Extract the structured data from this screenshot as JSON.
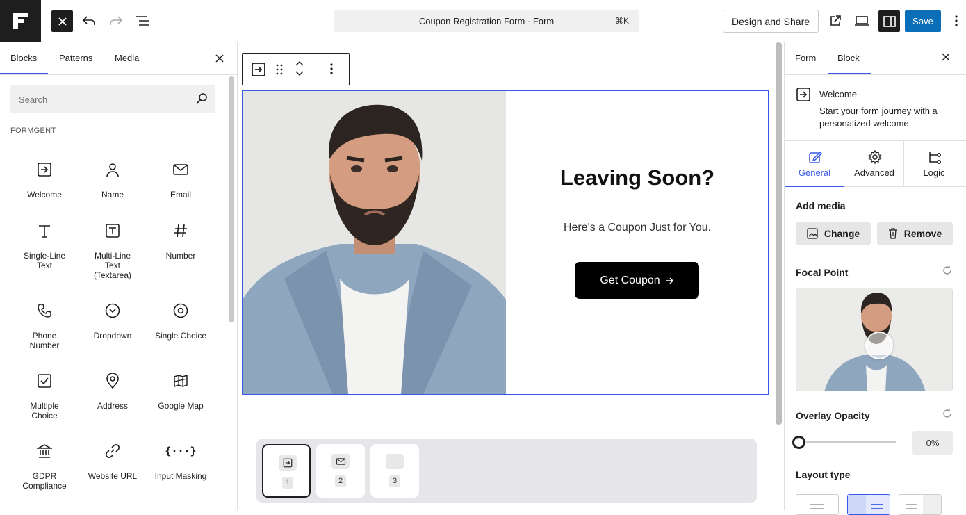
{
  "topbar": {
    "command_title": "Coupon Registration Form · Form",
    "command_shortcut": "⌘K",
    "design_share_label": "Design and Share",
    "save_label": "Save"
  },
  "inserter": {
    "tabs": [
      "Blocks",
      "Patterns",
      "Media"
    ],
    "search_placeholder": "Search",
    "category": "FORMGENT",
    "blocks": [
      {
        "label": "Welcome",
        "icon": "welcome-icon"
      },
      {
        "label": "Name",
        "icon": "person-icon"
      },
      {
        "label": "Email",
        "icon": "envelope-icon"
      },
      {
        "label": "Single-Line Text",
        "icon": "text-t-icon"
      },
      {
        "label": "Multi-Line Text (Textarea)",
        "icon": "text-box-icon"
      },
      {
        "label": "Number",
        "icon": "hash-icon"
      },
      {
        "label": "Phone Number",
        "icon": "phone-icon"
      },
      {
        "label": "Dropdown",
        "icon": "chevron-circle-icon"
      },
      {
        "label": "Single Choice",
        "icon": "radio-icon"
      },
      {
        "label": "Multiple Choice",
        "icon": "checkbox-icon"
      },
      {
        "label": "Address",
        "icon": "map-pin-icon"
      },
      {
        "label": "Google Map",
        "icon": "map-icon"
      },
      {
        "label": "GDPR Compliance",
        "icon": "bank-icon"
      },
      {
        "label": "Website URL",
        "icon": "link-icon"
      },
      {
        "label": "Input Masking",
        "icon": "braces-icon"
      }
    ]
  },
  "canvas": {
    "welcome": {
      "title": "Leaving Soon?",
      "subtitle": "Here's a Coupon Just for You.",
      "button_label": "Get Coupon"
    },
    "pages": [
      "1",
      "2",
      "3"
    ]
  },
  "sidebar": {
    "tabs": [
      "Form",
      "Block"
    ],
    "block_card": {
      "title": "Welcome",
      "description": "Start your form journey with a personalized welcome."
    },
    "settings_tabs": [
      "General",
      "Advanced",
      "Logic"
    ],
    "add_media_label": "Add media",
    "change_label": "Change",
    "remove_label": "Remove",
    "focal_point_label": "Focal Point",
    "overlay_opacity_label": "Overlay Opacity",
    "overlay_opacity_value": "0%",
    "overlay_opacity_fraction": 0,
    "layout_type_label": "Layout type"
  },
  "colors": {
    "accent": "#3858e9",
    "save": "#0a6fb8",
    "dark": "#1e1e1e"
  }
}
